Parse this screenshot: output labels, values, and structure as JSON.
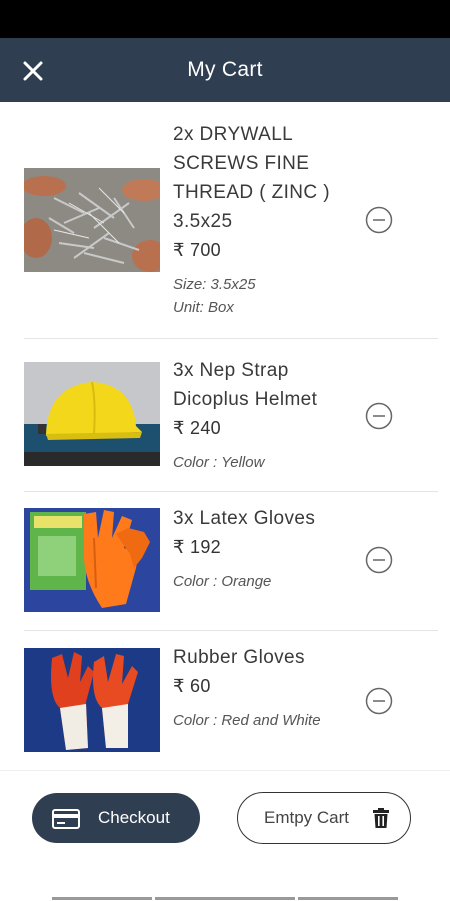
{
  "header": {
    "title": "My Cart",
    "close_icon": "close-icon"
  },
  "currency": "₹",
  "items": [
    {
      "name": "2x DRYWALL SCREWS FINE THREAD ( ZINC ) 3.5x25",
      "price": "₹ 700",
      "meta": [
        "Size: 3.5x25",
        "Unit: Box"
      ]
    },
    {
      "name": "3x Nep Strap Dicoplus Helmet",
      "price": "₹ 240",
      "meta": [
        "Color : Yellow"
      ]
    },
    {
      "name": "3x Latex Gloves",
      "price": "₹ 192",
      "meta": [
        "Color : Orange"
      ]
    },
    {
      "name": "Rubber Gloves",
      "price": "₹ 60",
      "meta": [
        "Color : Red and White"
      ]
    }
  ],
  "actions": {
    "checkout_label": "Checkout",
    "empty_label": "Emtpy Cart"
  },
  "colors": {
    "primary": "#2f3e51",
    "statusbar": "#000000"
  }
}
